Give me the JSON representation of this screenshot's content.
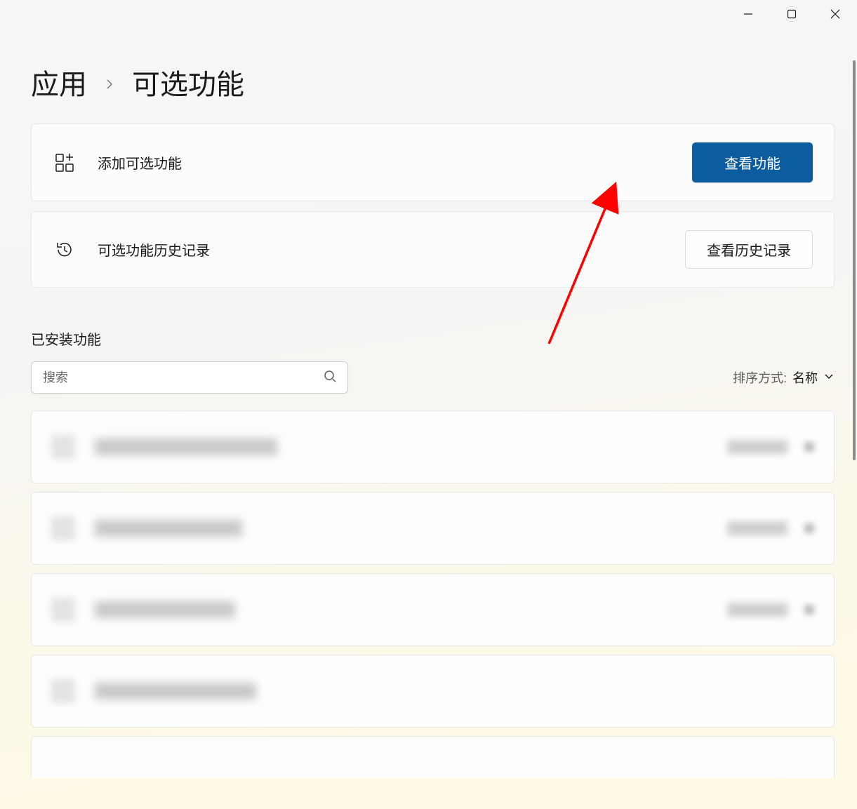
{
  "breadcrumb": {
    "parent": "应用",
    "current": "可选功能"
  },
  "add_feature": {
    "label": "添加可选功能",
    "button": "查看功能"
  },
  "history": {
    "label": "可选功能历史记录",
    "button": "查看历史记录"
  },
  "installed": {
    "header": "已安装功能",
    "search_placeholder": "搜索",
    "sort_label": "排序方式:",
    "sort_value": "名称"
  }
}
